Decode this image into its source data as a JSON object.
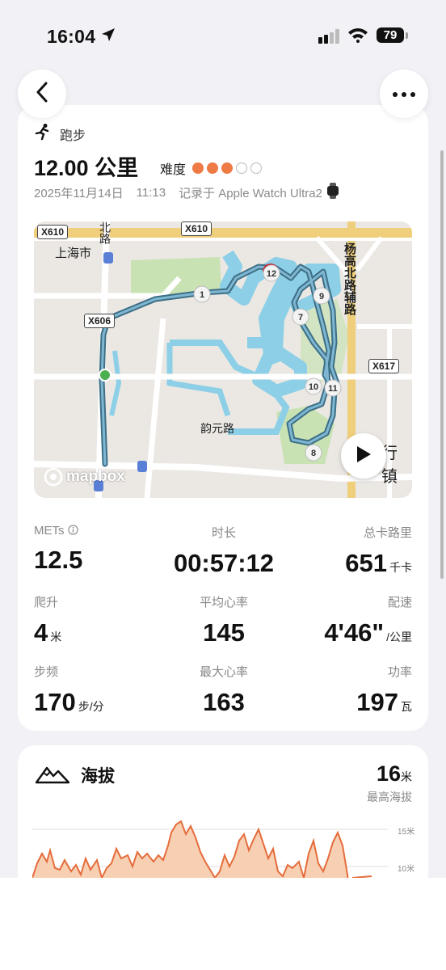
{
  "status_bar": {
    "time": "16:04",
    "battery": "79"
  },
  "workout": {
    "type": "跑步",
    "distance": "12.00 公里",
    "difficulty_label": "难度",
    "difficulty_level": 3,
    "difficulty_max": 5,
    "date": "2025年11月14日",
    "time": "11:13",
    "recorded_by": "记录于 Apple Watch Ultra2"
  },
  "map": {
    "labels": {
      "shanghai": "上海市",
      "beilu": "北路",
      "yunyuan": "韵元路",
      "yanggao": "杨高北路辅路",
      "town": "行镇",
      "x610a": "X610",
      "x610b": "X610",
      "x606": "X606",
      "x617": "X617",
      "mapbox": "mapbox"
    },
    "km_markers": [
      "1",
      "7",
      "8",
      "9",
      "10",
      "11",
      "12"
    ]
  },
  "stats": {
    "mets_label": "METs",
    "mets_value": "12.5",
    "duration_label": "时长",
    "duration_value": "00:57:12",
    "calories_label": "总卡路里",
    "calories_value": "651",
    "calories_unit": "千卡",
    "climb_label": "爬升",
    "climb_value": "4",
    "climb_unit": "米",
    "avg_hr_label": "平均心率",
    "avg_hr_value": "145",
    "pace_label": "配速",
    "pace_value": "4'46\"",
    "pace_unit": "/公里",
    "cadence_label": "步频",
    "cadence_value": "170",
    "cadence_unit": "步/分",
    "max_hr_label": "最大心率",
    "max_hr_value": "163",
    "power_label": "功率",
    "power_value": "197",
    "power_unit": "瓦"
  },
  "altitude": {
    "title": "海拔",
    "max_value": "16",
    "max_unit": "米",
    "max_label": "最高海拔",
    "grid_15": "15米",
    "grid_10": "10米"
  },
  "colors": {
    "accent": "#ee7a45",
    "route": "#3d6f86",
    "water": "#8ccfe6",
    "park": "#c9e2b3"
  }
}
